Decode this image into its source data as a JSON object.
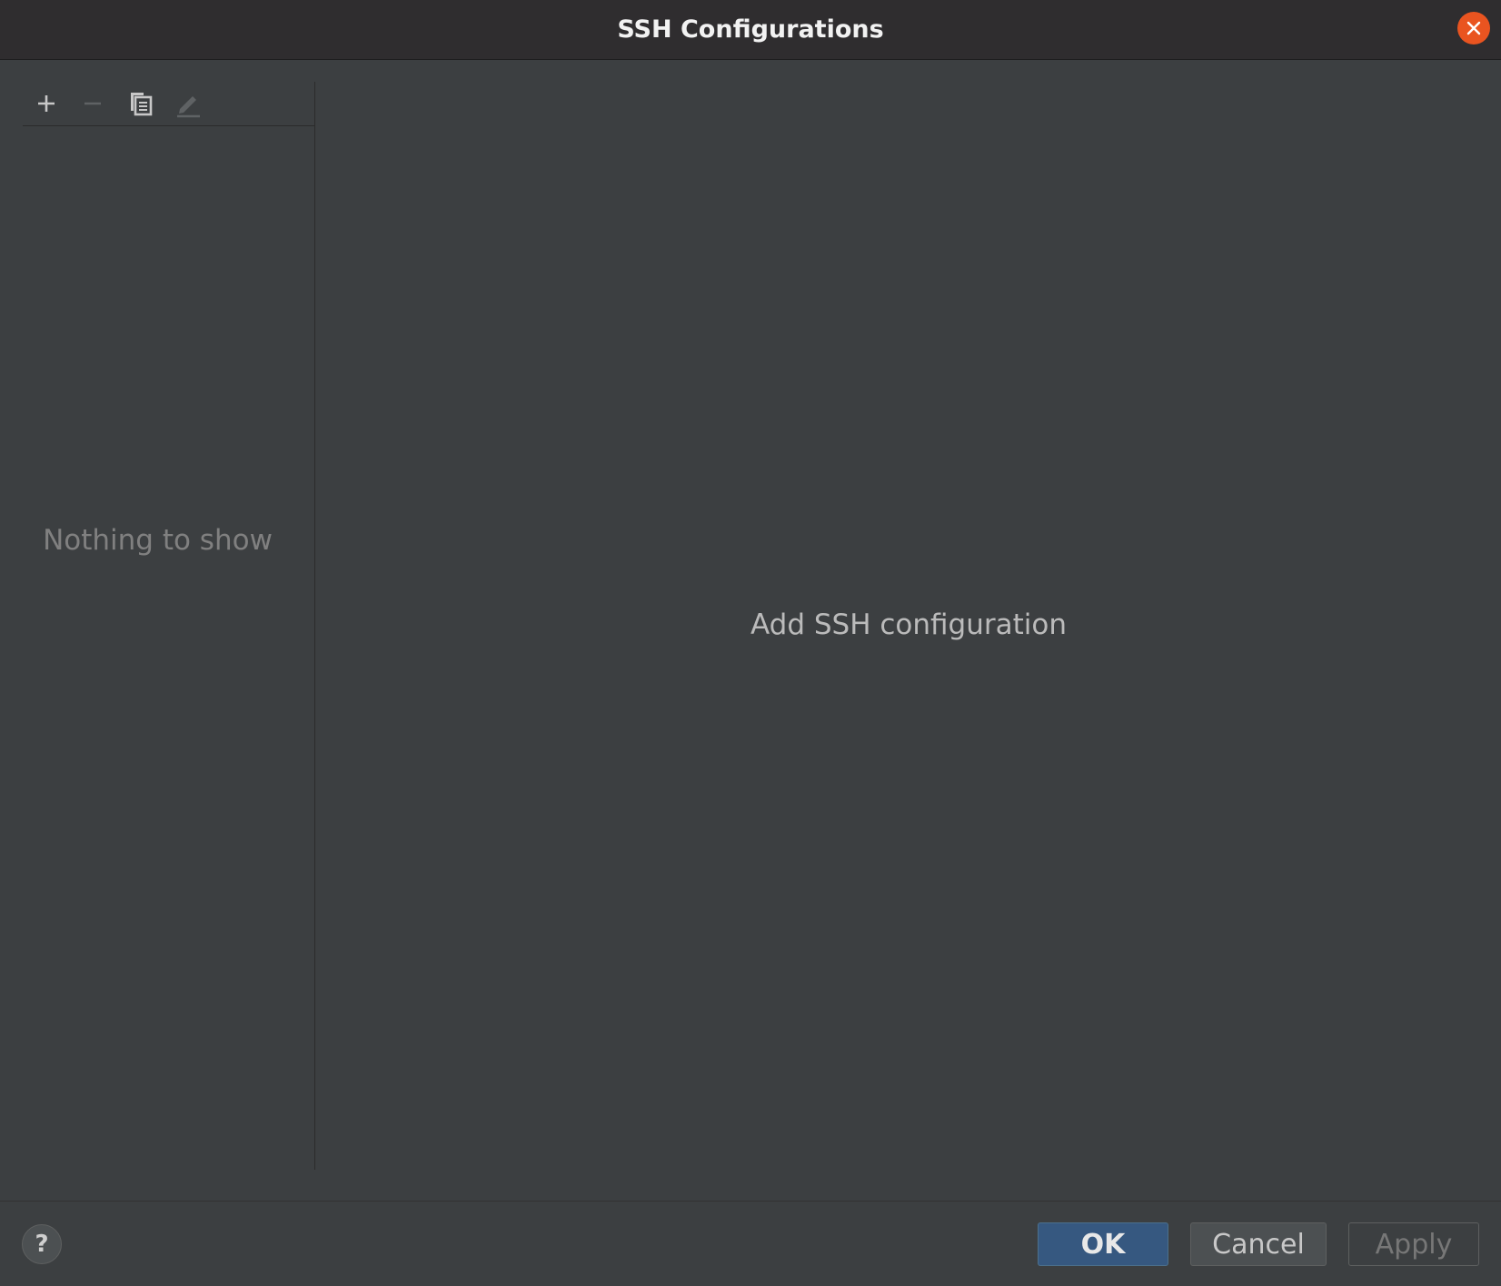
{
  "window": {
    "title": "SSH Configurations",
    "close_icon": "close-icon",
    "close_color": "#e95420"
  },
  "toolbar": {
    "items": [
      {
        "icon": "plus-icon",
        "label": "Add",
        "enabled": true
      },
      {
        "icon": "minus-icon",
        "label": "Remove",
        "enabled": false
      },
      {
        "icon": "copy-icon",
        "label": "Copy",
        "enabled": true
      },
      {
        "icon": "edit-icon",
        "label": "Edit",
        "enabled": false
      }
    ]
  },
  "list": {
    "empty_text": "Nothing to show"
  },
  "details": {
    "empty_text": "Add SSH configuration"
  },
  "footer": {
    "help_label": "?",
    "ok_label": "OK",
    "cancel_label": "Cancel",
    "apply_label": "Apply",
    "ok_color": "#365880"
  }
}
